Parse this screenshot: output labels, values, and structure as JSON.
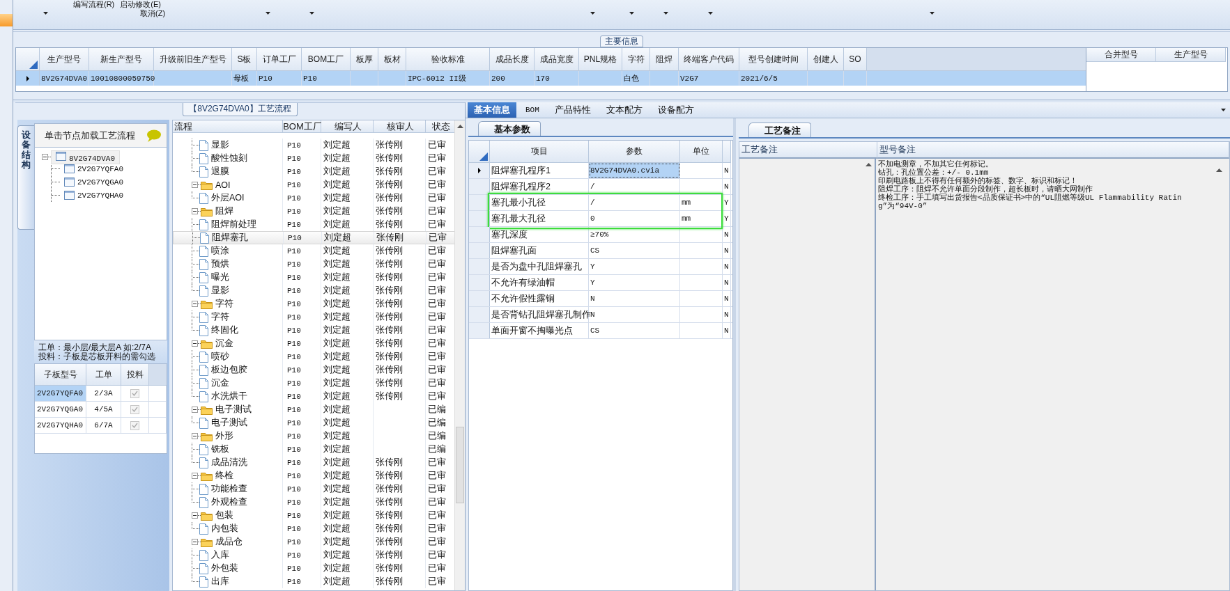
{
  "toolbar": {
    "menu_items": [
      "编写流程(R)",
      "启动修改(E)",
      "取消(Z)"
    ]
  },
  "main_info": {
    "title": "主要信息",
    "columns": [
      "生产型号",
      "新生产型号",
      "升级前旧生产型号",
      "S板",
      "订单工厂",
      "BOM工厂",
      "板厚",
      "板材",
      "验收标准",
      "成品长度",
      "成品宽度",
      "PNL规格",
      "字符",
      "阻焊",
      "终端客户代码",
      "型号创建时间",
      "创建人",
      "SO"
    ],
    "rows": [
      {
        "selected": true,
        "cells": [
          "8V2G74DVA0",
          "10010800059750",
          null,
          "母板",
          "P10",
          "P10",
          null,
          null,
          "IPC-6012 II级",
          "200",
          "170",
          null,
          "白色",
          null,
          "V2G7",
          "2021/6/5",
          null,
          null
        ]
      }
    ],
    "merge_columns": [
      "合并型号",
      "生产型号"
    ]
  },
  "process_panel": {
    "title": "【8V2G74DVA0】工艺流程",
    "side_tab": "设备结构",
    "hint": "单击节点加载工艺流程",
    "board_tree": {
      "name": "8V2G74DVA0",
      "expanded": true,
      "children": [
        {
          "name": "2V2G7YQFA0"
        },
        {
          "name": "2V2G7YQGA0"
        },
        {
          "name": "2V2G7YQHA0"
        }
      ]
    },
    "notes": [
      "工单：最小层/最大层A 如:2/7A",
      "投料：子板是芯板开料的需勾选"
    ],
    "sub_boards": {
      "columns": [
        "子板型号",
        "工单",
        "投料"
      ],
      "rows": [
        {
          "board": "2V2G7YQFA0",
          "order": "2/3A",
          "feed": true,
          "selected": true
        },
        {
          "board": "2V2G7YQGA0",
          "order": "4/5A",
          "feed": true,
          "selected": false
        },
        {
          "board": "2V2G7YQHA0",
          "order": "6/7A",
          "feed": true,
          "selected": false
        }
      ]
    },
    "flow": {
      "columns": [
        "流程",
        "BOM工厂",
        "编写人",
        "核审人",
        "状态"
      ],
      "steps": [
        {
          "children": [
            {
              "name": "显影",
              "bom": "P10",
              "writer": "刘定超",
              "reviewer": "张传刚",
              "status": "已审",
              "selected": false
            },
            {
              "name": "酸性蚀刻",
              "bom": "P10",
              "writer": "刘定超",
              "reviewer": "张传刚",
              "status": "已审",
              "selected": false
            },
            {
              "name": "退膜",
              "bom": "P10",
              "writer": "刘定超",
              "reviewer": "张传刚",
              "status": "已审",
              "selected": false
            }
          ]
        },
        {
          "name": "AOI",
          "bom": "P10",
          "writer": "刘定超",
          "reviewer": "张传刚",
          "status": "已审",
          "selected": false,
          "expanded": true,
          "children": [
            {
              "name": "外层AOI",
              "bom": "P10",
              "writer": "刘定超",
              "reviewer": "张传刚",
              "status": "已审",
              "selected": false
            }
          ]
        },
        {
          "name": "阻焊",
          "bom": "P10",
          "writer": "刘定超",
          "reviewer": "张传刚",
          "status": "已审",
          "selected": false,
          "expanded": true,
          "children": [
            {
              "name": "阻焊前处理",
              "bom": "P10",
              "writer": "刘定超",
              "reviewer": "张传刚",
              "status": "已审",
              "selected": false
            },
            {
              "name": "阻焊塞孔",
              "bom": "P10",
              "writer": "刘定超",
              "reviewer": "张传刚",
              "status": "已审",
              "selected": true
            },
            {
              "name": "喷涂",
              "bom": "P10",
              "writer": "刘定超",
              "reviewer": "张传刚",
              "status": "已审",
              "selected": false
            },
            {
              "name": "预烘",
              "bom": "P10",
              "writer": "刘定超",
              "reviewer": "张传刚",
              "status": "已审",
              "selected": false
            },
            {
              "name": "曝光",
              "bom": "P10",
              "writer": "刘定超",
              "reviewer": "张传刚",
              "status": "已审",
              "selected": false
            },
            {
              "name": "显影",
              "bom": "P10",
              "writer": "刘定超",
              "reviewer": "张传刚",
              "status": "已审",
              "selected": false
            }
          ]
        },
        {
          "name": "字符",
          "bom": "P10",
          "writer": "刘定超",
          "reviewer": "张传刚",
          "status": "已审",
          "selected": false,
          "expanded": true,
          "children": [
            {
              "name": "字符",
              "bom": "P10",
              "writer": "刘定超",
              "reviewer": "张传刚",
              "status": "已审",
              "selected": false
            },
            {
              "name": "终固化",
              "bom": "P10",
              "writer": "刘定超",
              "reviewer": "张传刚",
              "status": "已审",
              "selected": false
            }
          ]
        },
        {
          "name": "沉金",
          "bom": "P10",
          "writer": "刘定超",
          "reviewer": "张传刚",
          "status": "已审",
          "selected": false,
          "expanded": true,
          "children": [
            {
              "name": "喷砂",
              "bom": "P10",
              "writer": "刘定超",
              "reviewer": "张传刚",
              "status": "已审",
              "selected": false
            },
            {
              "name": "板边包胶",
              "bom": "P10",
              "writer": "刘定超",
              "reviewer": "张传刚",
              "status": "已审",
              "selected": false
            },
            {
              "name": "沉金",
              "bom": "P10",
              "writer": "刘定超",
              "reviewer": "张传刚",
              "status": "已审",
              "selected": false
            },
            {
              "name": "水洗烘干",
              "bom": "P10",
              "writer": "刘定超",
              "reviewer": "张传刚",
              "status": "已审",
              "selected": false
            }
          ]
        },
        {
          "name": "电子测试",
          "bom": "P10",
          "writer": "刘定超",
          "status": "已编",
          "selected": false,
          "expanded": true,
          "children": [
            {
              "name": "电子测试",
              "bom": "P10",
              "writer": "刘定超",
              "status": "已编",
              "selected": false
            }
          ]
        },
        {
          "name": "外形",
          "bom": "P10",
          "writer": "刘定超",
          "status": "已编",
          "selected": false,
          "expanded": true,
          "children": [
            {
              "name": "铣板",
              "bom": "P10",
              "writer": "刘定超",
              "status": "已编",
              "selected": false
            },
            {
              "name": "成品清洗",
              "bom": "P10",
              "writer": "刘定超",
              "reviewer": "张传刚",
              "status": "已审",
              "selected": false
            }
          ]
        },
        {
          "name": "终检",
          "bom": "P10",
          "writer": "刘定超",
          "reviewer": "张传刚",
          "status": "已审",
          "selected": false,
          "expanded": true,
          "children": [
            {
              "name": "功能检查",
              "bom": "P10",
              "writer": "刘定超",
              "reviewer": "张传刚",
              "status": "已审",
              "selected": false
            },
            {
              "name": "外观检查",
              "bom": "P10",
              "writer": "刘定超",
              "reviewer": "张传刚",
              "status": "已审",
              "selected": false
            }
          ]
        },
        {
          "name": "包装",
          "bom": "P10",
          "writer": "刘定超",
          "reviewer": "张传刚",
          "status": "已审",
          "selected": false,
          "expanded": true,
          "children": [
            {
              "name": "内包装",
              "bom": "P10",
              "writer": "刘定超",
              "reviewer": "张传刚",
              "status": "已审",
              "selected": false
            }
          ]
        },
        {
          "name": "成品仓",
          "bom": "P10",
          "writer": "刘定超",
          "reviewer": "张传刚",
          "status": "已审",
          "selected": false,
          "expanded": true,
          "children": [
            {
              "name": "入库",
              "bom": "P10",
              "writer": "刘定超",
              "reviewer": "张传刚",
              "status": "已审",
              "selected": false
            },
            {
              "name": "外包装",
              "bom": "P10",
              "writer": "刘定超",
              "reviewer": "张传刚",
              "status": "已审",
              "selected": false
            },
            {
              "name": "出库",
              "bom": "P10",
              "writer": "刘定超",
              "reviewer": "张传刚",
              "status": "已审",
              "selected": false
            }
          ]
        }
      ]
    }
  },
  "detail": {
    "tabs": [
      {
        "label": "基本信息",
        "selected": true
      },
      {
        "label": "BOM",
        "selected": false
      },
      {
        "label": "产品特性",
        "selected": false
      },
      {
        "label": "文本配方",
        "selected": false
      },
      {
        "label": "设备配方",
        "selected": false
      }
    ],
    "params": {
      "tab": "基本参数",
      "columns": [
        "项目",
        "参数",
        "单位"
      ],
      "rows": [
        {
          "item": "阻焊塞孔程序1",
          "value": "8V2G74DVA0.cvia",
          "column_4": "N",
          "selected": true,
          "highlighted": false
        },
        {
          "item": "阻焊塞孔程序2",
          "value": "/",
          "column_4": "N",
          "selected": false,
          "highlighted": false
        },
        {
          "item": "塞孔最小孔径",
          "value": "/",
          "unit": "mm",
          "column_4": "Y",
          "selected": false,
          "highlighted": true
        },
        {
          "item": "塞孔最大孔径",
          "value": "0",
          "unit": "mm",
          "column_4": "Y",
          "selected": false,
          "highlighted": true
        },
        {
          "item": "塞孔深度",
          "value": "≥70%",
          "column_4": "N",
          "selected": false,
          "highlighted": false
        },
        {
          "item": "阻焊塞孔面",
          "value": "CS",
          "column_4": "N",
          "selected": false,
          "highlighted": false
        },
        {
          "item": "是否为盘中孔阻焊塞孔",
          "value": "Y",
          "column_4": "N",
          "selected": false,
          "highlighted": false
        },
        {
          "item": "不允许有绿油帽",
          "value": "Y",
          "column_4": "N",
          "selected": false,
          "highlighted": false
        },
        {
          "item": "不允许假性露铜",
          "value": "N",
          "column_4": "N",
          "selected": false,
          "highlighted": false
        },
        {
          "item": "是否背钻孔阻焊塞孔制作",
          "value": "N",
          "column_4": "N",
          "selected": false,
          "highlighted": false
        },
        {
          "item": "单面开窗不掏曝光点",
          "value": "CS",
          "column_4": "N",
          "selected": false,
          "highlighted": false
        }
      ]
    },
    "remarks": {
      "tab": "工艺备注",
      "columns": [
        "工艺备注",
        "型号备注"
      ],
      "model_remark_lines": [
        "不加电测章，不加其它任何标记。",
        "钻孔：孔位置公差：+/- 0.1mm",
        "印刷电路板上不得有任何额外的标签、数字、标识和标记！",
        "阻焊工序：阻焊不允许单面分段制作，超长板时，请晒大网制作",
        "终检工序：手工填写出货报告<品质保证书>中的“UL阻燃等级UL Flammability Rating”为“94V-0”"
      ]
    }
  }
}
